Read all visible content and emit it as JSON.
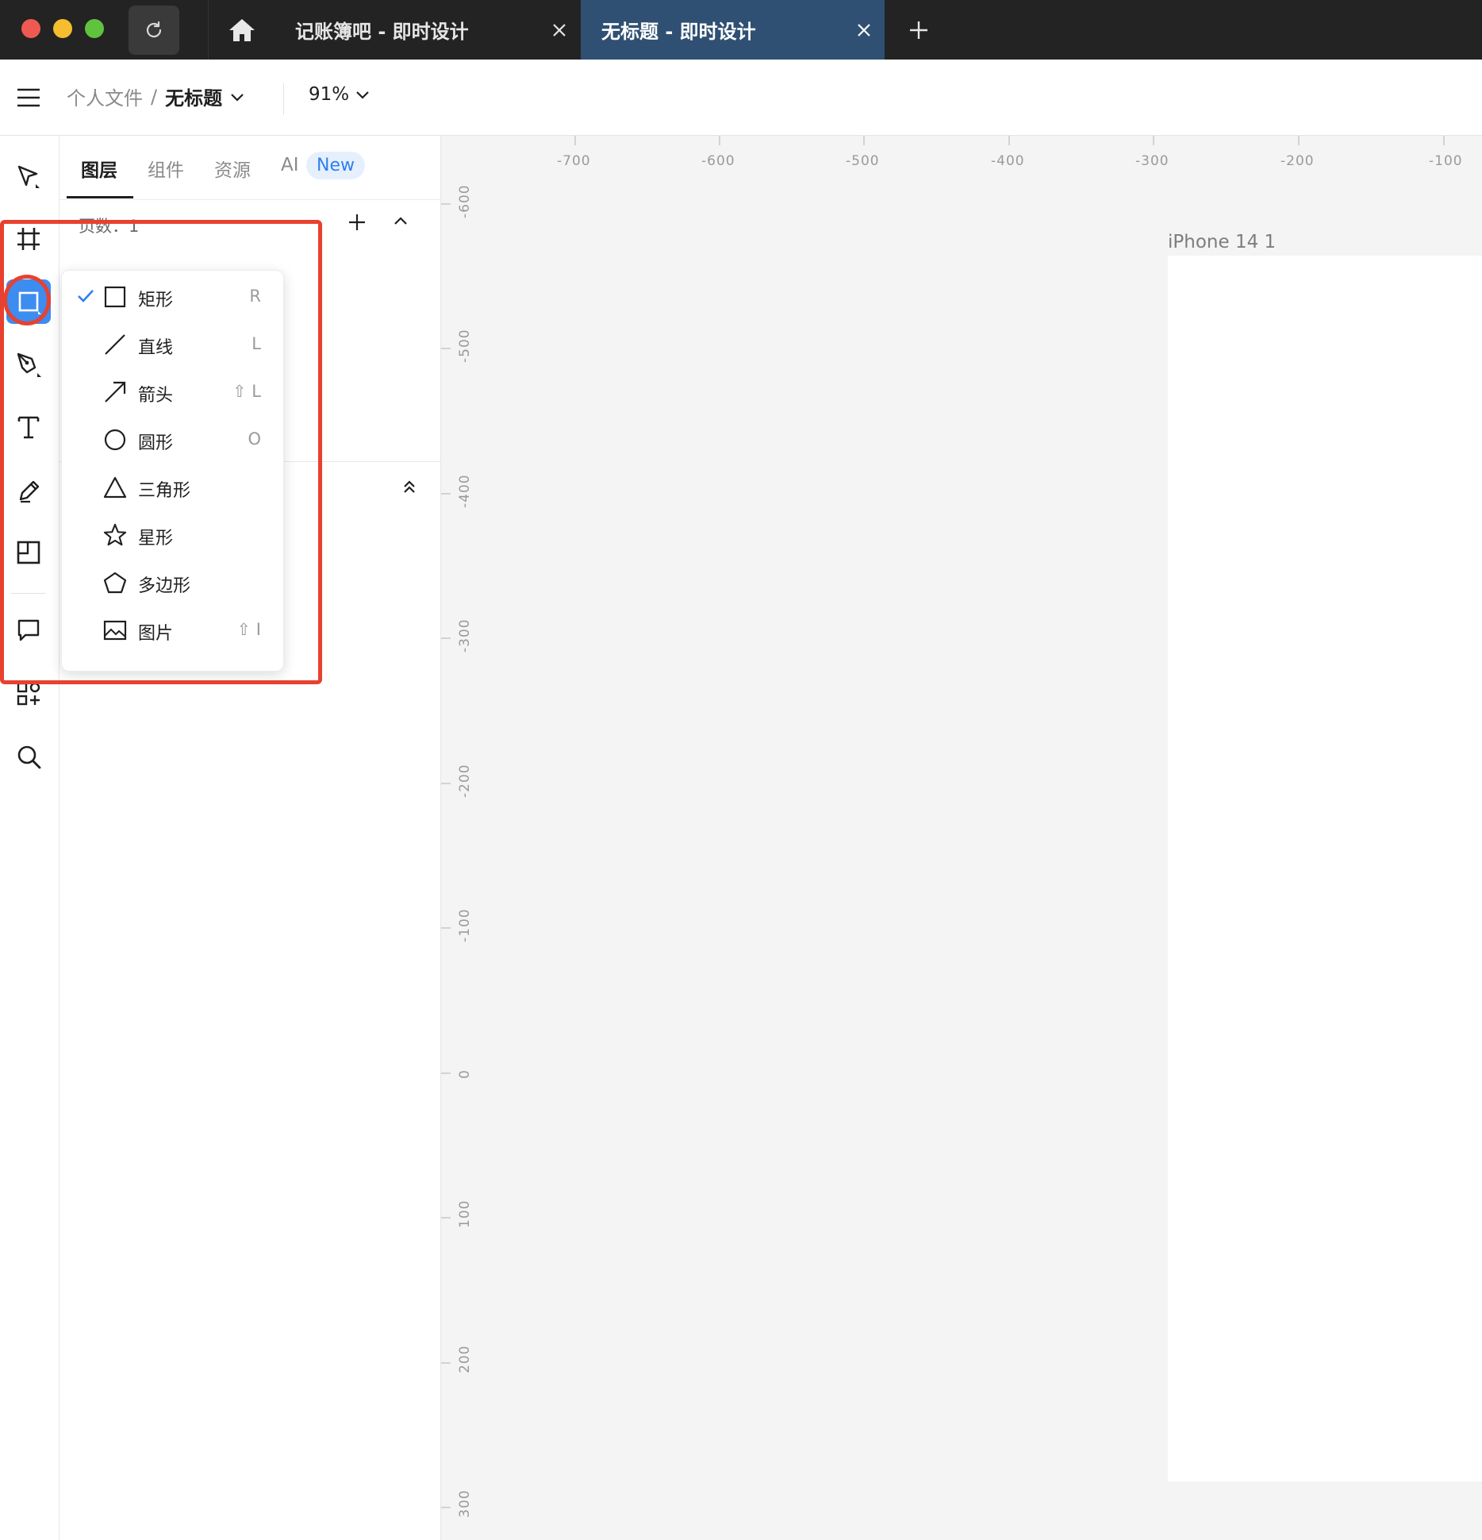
{
  "window": {
    "traffic_lights": {
      "close": "#ee5a52",
      "minimize": "#f5bd2f",
      "maximize": "#5fc33d"
    },
    "tabs": [
      {
        "label": "记账簿吧 - 即时设计",
        "active": false
      },
      {
        "label": "无标题 - 即时设计",
        "active": true
      }
    ],
    "active_tab_color": "#2f5073"
  },
  "toolbar": {
    "breadcrumb_root": "个人文件",
    "breadcrumb_sep": "/",
    "document_title": "无标题",
    "zoom": "91%"
  },
  "tools": [
    {
      "name": "move-tool",
      "icon": "pointer-icon",
      "active": false
    },
    {
      "name": "frame-tool",
      "icon": "frame-hash-icon",
      "active": false
    },
    {
      "name": "rectangle-tool",
      "icon": "rectangle-icon",
      "active": true
    },
    {
      "name": "pen-tool",
      "icon": "pen-nib-icon",
      "active": false
    },
    {
      "name": "text-tool",
      "icon": "text-icon",
      "active": false
    },
    {
      "name": "pencil-tool",
      "icon": "pencil-icon",
      "active": false
    },
    {
      "name": "slice-tool",
      "icon": "slice-icon",
      "active": false
    },
    {
      "name": "comment-tool",
      "icon": "comment-icon",
      "active": false
    },
    {
      "name": "plugins-tool",
      "icon": "plugins-icon",
      "active": false
    },
    {
      "name": "search-tool",
      "icon": "search-icon",
      "active": false
    }
  ],
  "panel": {
    "tabs": [
      "图层",
      "组件",
      "资源",
      "AI"
    ],
    "new_badge": "New",
    "pages_label": "页数：1"
  },
  "shape_menu": {
    "items": [
      {
        "label": "矩形",
        "shortcut": "R",
        "icon": "rectangle-icon",
        "checked": true
      },
      {
        "label": "直线",
        "shortcut": "L",
        "icon": "line-icon",
        "checked": false
      },
      {
        "label": "箭头",
        "shortcut": "⇧ L",
        "icon": "arrow-icon",
        "checked": false
      },
      {
        "label": "圆形",
        "shortcut": "O",
        "icon": "ellipse-icon",
        "checked": false
      },
      {
        "label": "三角形",
        "shortcut": "",
        "icon": "triangle-icon",
        "checked": false
      },
      {
        "label": "星形",
        "shortcut": "",
        "icon": "star-icon",
        "checked": false
      },
      {
        "label": "多边形",
        "shortcut": "",
        "icon": "polygon-icon",
        "checked": false
      },
      {
        "label": "图片",
        "shortcut": "⇧ I",
        "icon": "image-icon",
        "checked": false
      }
    ]
  },
  "canvas": {
    "h_ruler_labels": [
      "-700",
      "-600",
      "-500",
      "-400",
      "-300",
      "-200",
      "-100"
    ],
    "v_ruler_labels": [
      "-600",
      "-500",
      "-400",
      "-300",
      "-200",
      "-100",
      "0",
      "100",
      "200",
      "300"
    ],
    "frame_label": "iPhone 14 1"
  },
  "annotation_color": "#e8412f"
}
